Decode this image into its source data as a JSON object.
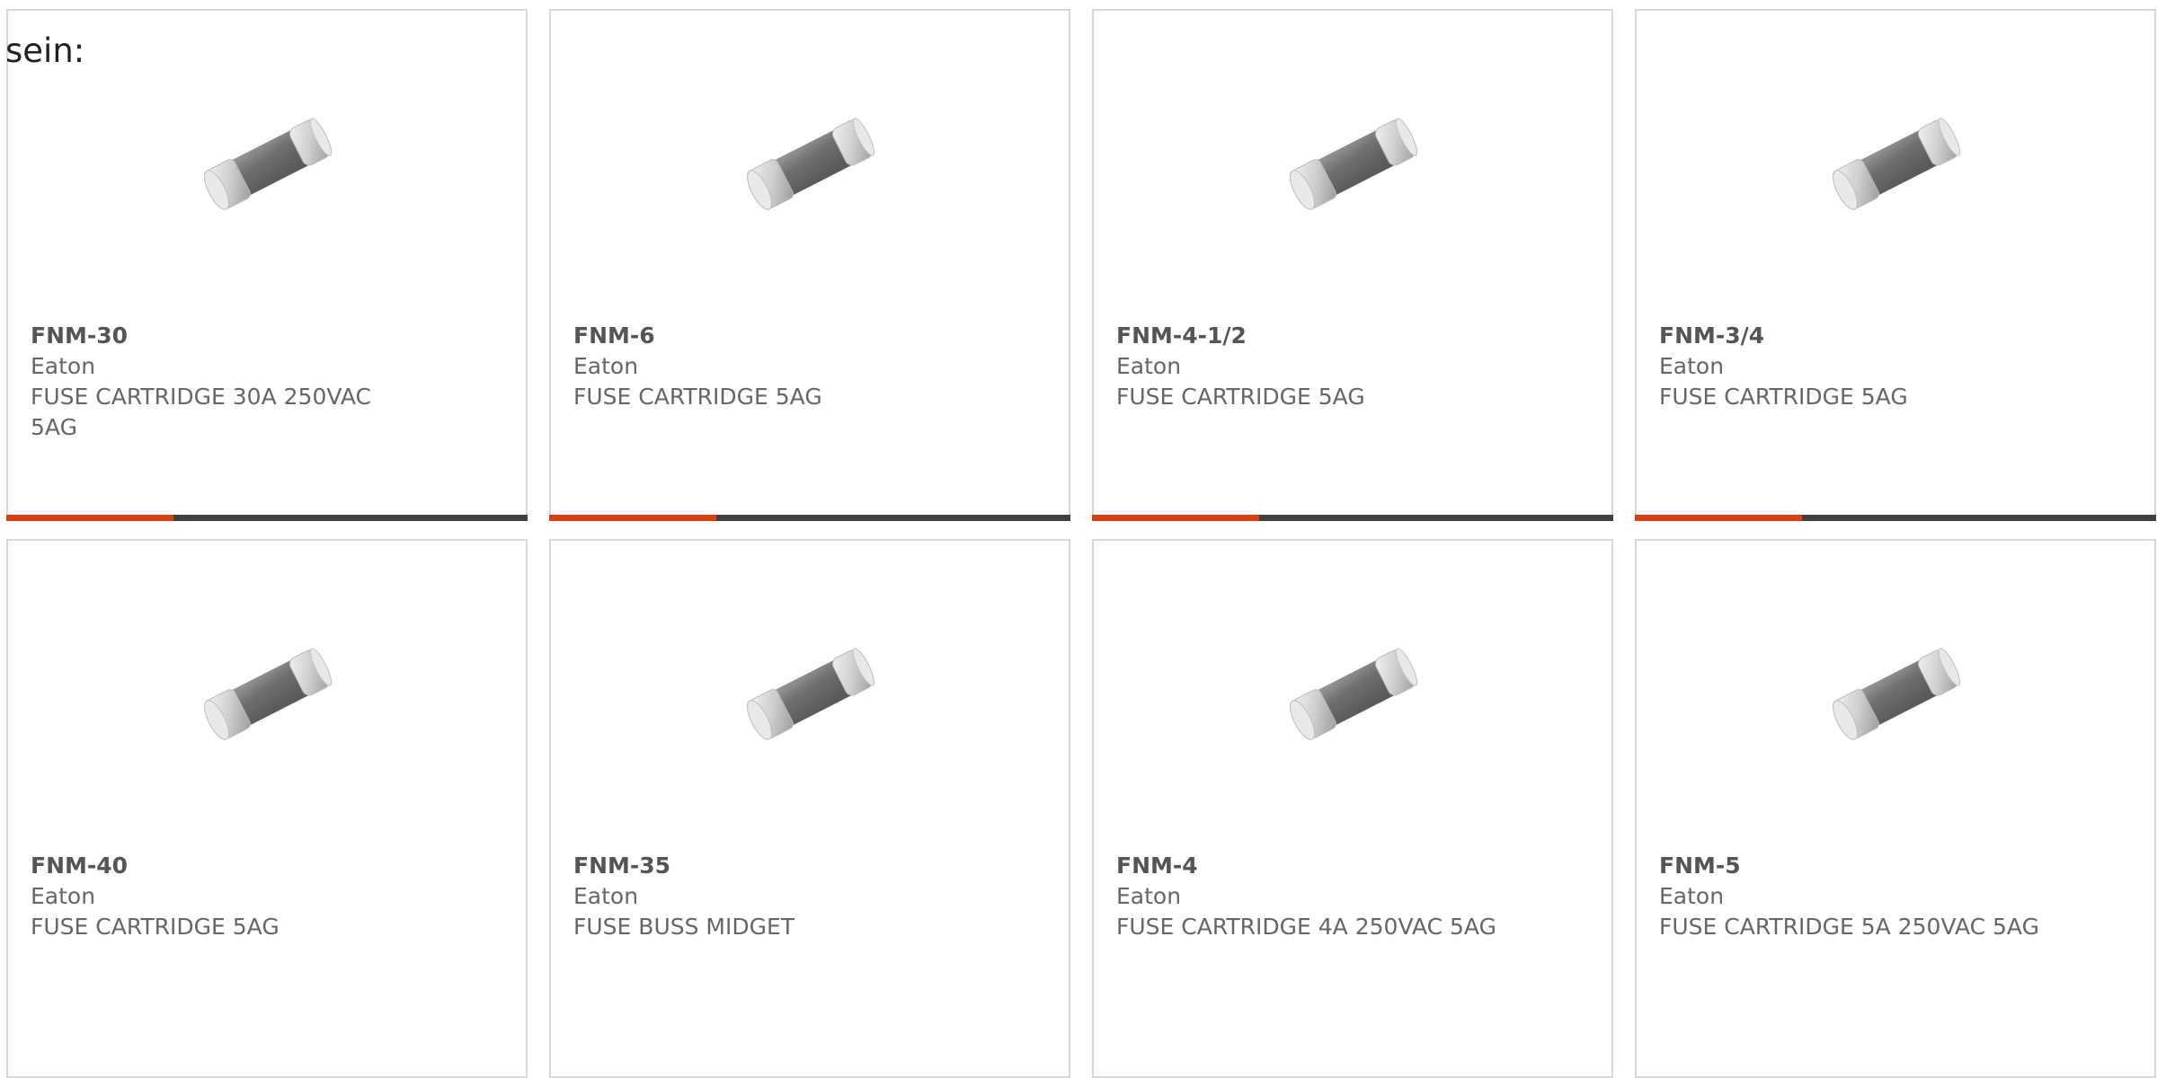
{
  "intro_text": "sein:",
  "colors": {
    "accent": "#d84012",
    "bar_track": "#404040",
    "card_border": "#d8d8d8",
    "text": "#666666"
  },
  "products": [
    {
      "part_number": "FNM-30",
      "manufacturer": "Eaton",
      "description": "FUSE CARTRIDGE 30A 250VAC 5AG",
      "progress": 0.32,
      "icon": "fuse-cartridge-icon"
    },
    {
      "part_number": "FNM-6",
      "manufacturer": "Eaton",
      "description": "FUSE CARTRIDGE 5AG",
      "progress": 0.32,
      "icon": "fuse-cartridge-icon"
    },
    {
      "part_number": "FNM-4-1/2",
      "manufacturer": "Eaton",
      "description": "FUSE CARTRIDGE 5AG",
      "progress": 0.32,
      "icon": "fuse-cartridge-icon"
    },
    {
      "part_number": "FNM-3/4",
      "manufacturer": "Eaton",
      "description": "FUSE CARTRIDGE 5AG",
      "progress": 0.32,
      "icon": "fuse-cartridge-icon"
    },
    {
      "part_number": "FNM-40",
      "manufacturer": "Eaton",
      "description": "FUSE CARTRIDGE 5AG",
      "icon": "fuse-cartridge-icon"
    },
    {
      "part_number": "FNM-35",
      "manufacturer": "Eaton",
      "description": "FUSE BUSS MIDGET",
      "icon": "fuse-cartridge-icon"
    },
    {
      "part_number": "FNM-4",
      "manufacturer": "Eaton",
      "description": "FUSE CARTRIDGE 4A 250VAC 5AG",
      "icon": "fuse-cartridge-icon"
    },
    {
      "part_number": "FNM-5",
      "manufacturer": "Eaton",
      "description": "FUSE CARTRIDGE 5A 250VAC 5AG",
      "icon": "fuse-cartridge-icon"
    }
  ]
}
